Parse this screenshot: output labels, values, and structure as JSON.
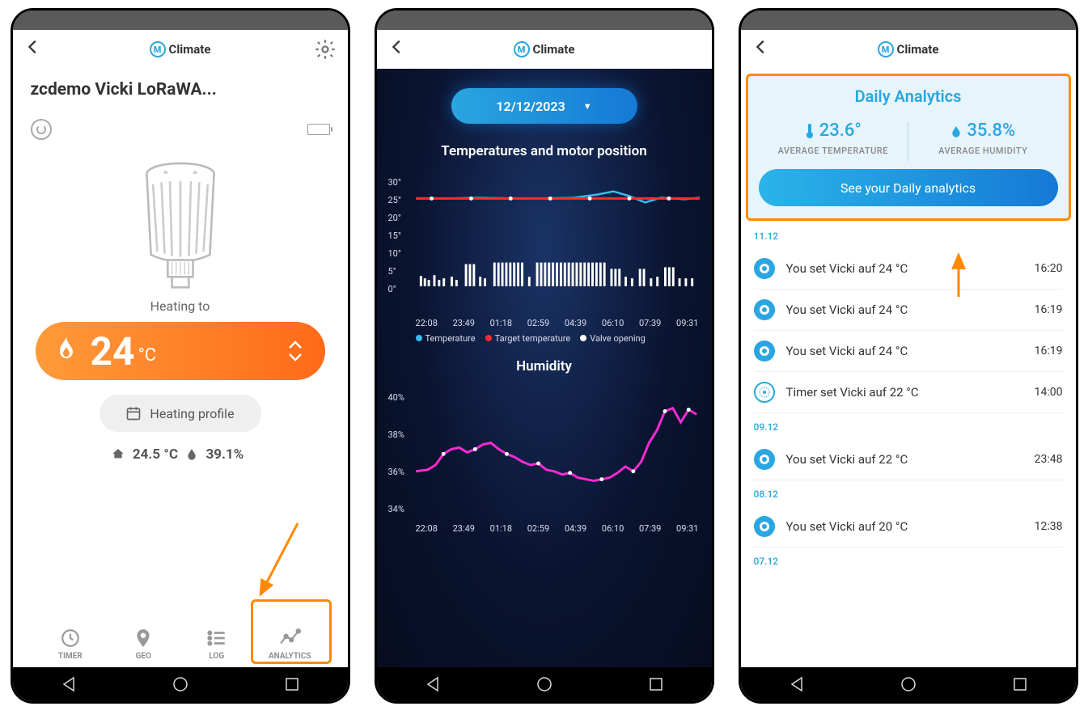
{
  "brand": "Climate",
  "screen1": {
    "device_name": "zcdemo Vicki LoRaWA...",
    "heating_label": "Heating to",
    "target_temp": "24",
    "target_unit": "°C",
    "profile_label": "Heating profile",
    "current_temp": "24.5 °C",
    "current_hum": "39.1%",
    "tabs": {
      "timer": "TIMER",
      "geo": "GEO",
      "log": "LOG",
      "analytics": "ANALYTICS"
    }
  },
  "screen2": {
    "date": "12/12/2023",
    "chart1_title": "Temperatures and motor position",
    "chart2_title": "Humidity",
    "legend_temp": "Temperature",
    "legend_target": "Target temperature",
    "legend_valve": "Valve opening",
    "temp_ticks": [
      "30°",
      "25°",
      "20°",
      "15°",
      "10°",
      "5°",
      "0°"
    ],
    "hum_ticks": [
      "40%",
      "38%",
      "36%",
      "34%"
    ],
    "x_ticks": [
      "22:08",
      "23:49",
      "01:18",
      "02:59",
      "04:39",
      "06:10",
      "07:39",
      "09:31"
    ]
  },
  "screen3": {
    "title": "Daily Analytics",
    "avg_temp_val": "23.6°",
    "avg_temp_lbl": "AVERAGE TEMPERATURE",
    "avg_hum_val": "35.8%",
    "avg_hum_lbl": "AVERAGE HUMIDITY",
    "cta": "See your Daily analytics",
    "groups": [
      {
        "date": "11.12",
        "rows": [
          {
            "text": "You set Vicki auf 24 °C",
            "time": "16:20",
            "icon": "ring"
          },
          {
            "text": "You set Vicki auf 24 °C",
            "time": "16:19",
            "icon": "ring"
          },
          {
            "text": "You set Vicki auf 24 °C",
            "time": "16:19",
            "icon": "ring"
          },
          {
            "text": "Timer set Vicki auf 22 °C",
            "time": "14:00",
            "icon": "target"
          }
        ]
      },
      {
        "date": "09.12",
        "rows": [
          {
            "text": "You set Vicki auf 22 °C",
            "time": "23:48",
            "icon": "ring"
          }
        ]
      },
      {
        "date": "08.12",
        "rows": [
          {
            "text": "You set Vicki auf 20 °C",
            "time": "12:38",
            "icon": "ring"
          }
        ]
      },
      {
        "date": "07.12",
        "rows": []
      }
    ]
  },
  "chart_data": [
    {
      "type": "line",
      "title": "Temperatures and motor position",
      "xlabel": "",
      "ylabel": "°",
      "x": [
        "22:08",
        "23:49",
        "01:18",
        "02:59",
        "04:39",
        "06:10",
        "07:39",
        "09:31"
      ],
      "ylim": [
        0,
        30
      ],
      "series": [
        {
          "name": "Target temperature",
          "color": "#ff2a2a",
          "values": [
            24,
            24,
            24,
            24,
            24,
            24,
            24,
            24
          ]
        },
        {
          "name": "Temperature",
          "color": "#3bbcf0",
          "values": [
            24,
            24,
            24,
            24,
            24,
            25,
            23,
            24
          ]
        },
        {
          "name": "Valve opening",
          "color": "#ffffff",
          "kind": "bar",
          "values": [
            3,
            2,
            3,
            6,
            6,
            6,
            5,
            3
          ]
        }
      ]
    },
    {
      "type": "line",
      "title": "Humidity",
      "xlabel": "",
      "ylabel": "%",
      "x": [
        "22:08",
        "23:49",
        "01:18",
        "02:59",
        "04:39",
        "06:10",
        "07:39",
        "09:31"
      ],
      "ylim": [
        34,
        40
      ],
      "series": [
        {
          "name": "Humidity",
          "color": "#ff2ad4",
          "values": [
            36.0,
            36.8,
            37.0,
            36.5,
            36.0,
            35.8,
            35.6,
            39.2
          ]
        }
      ]
    }
  ]
}
